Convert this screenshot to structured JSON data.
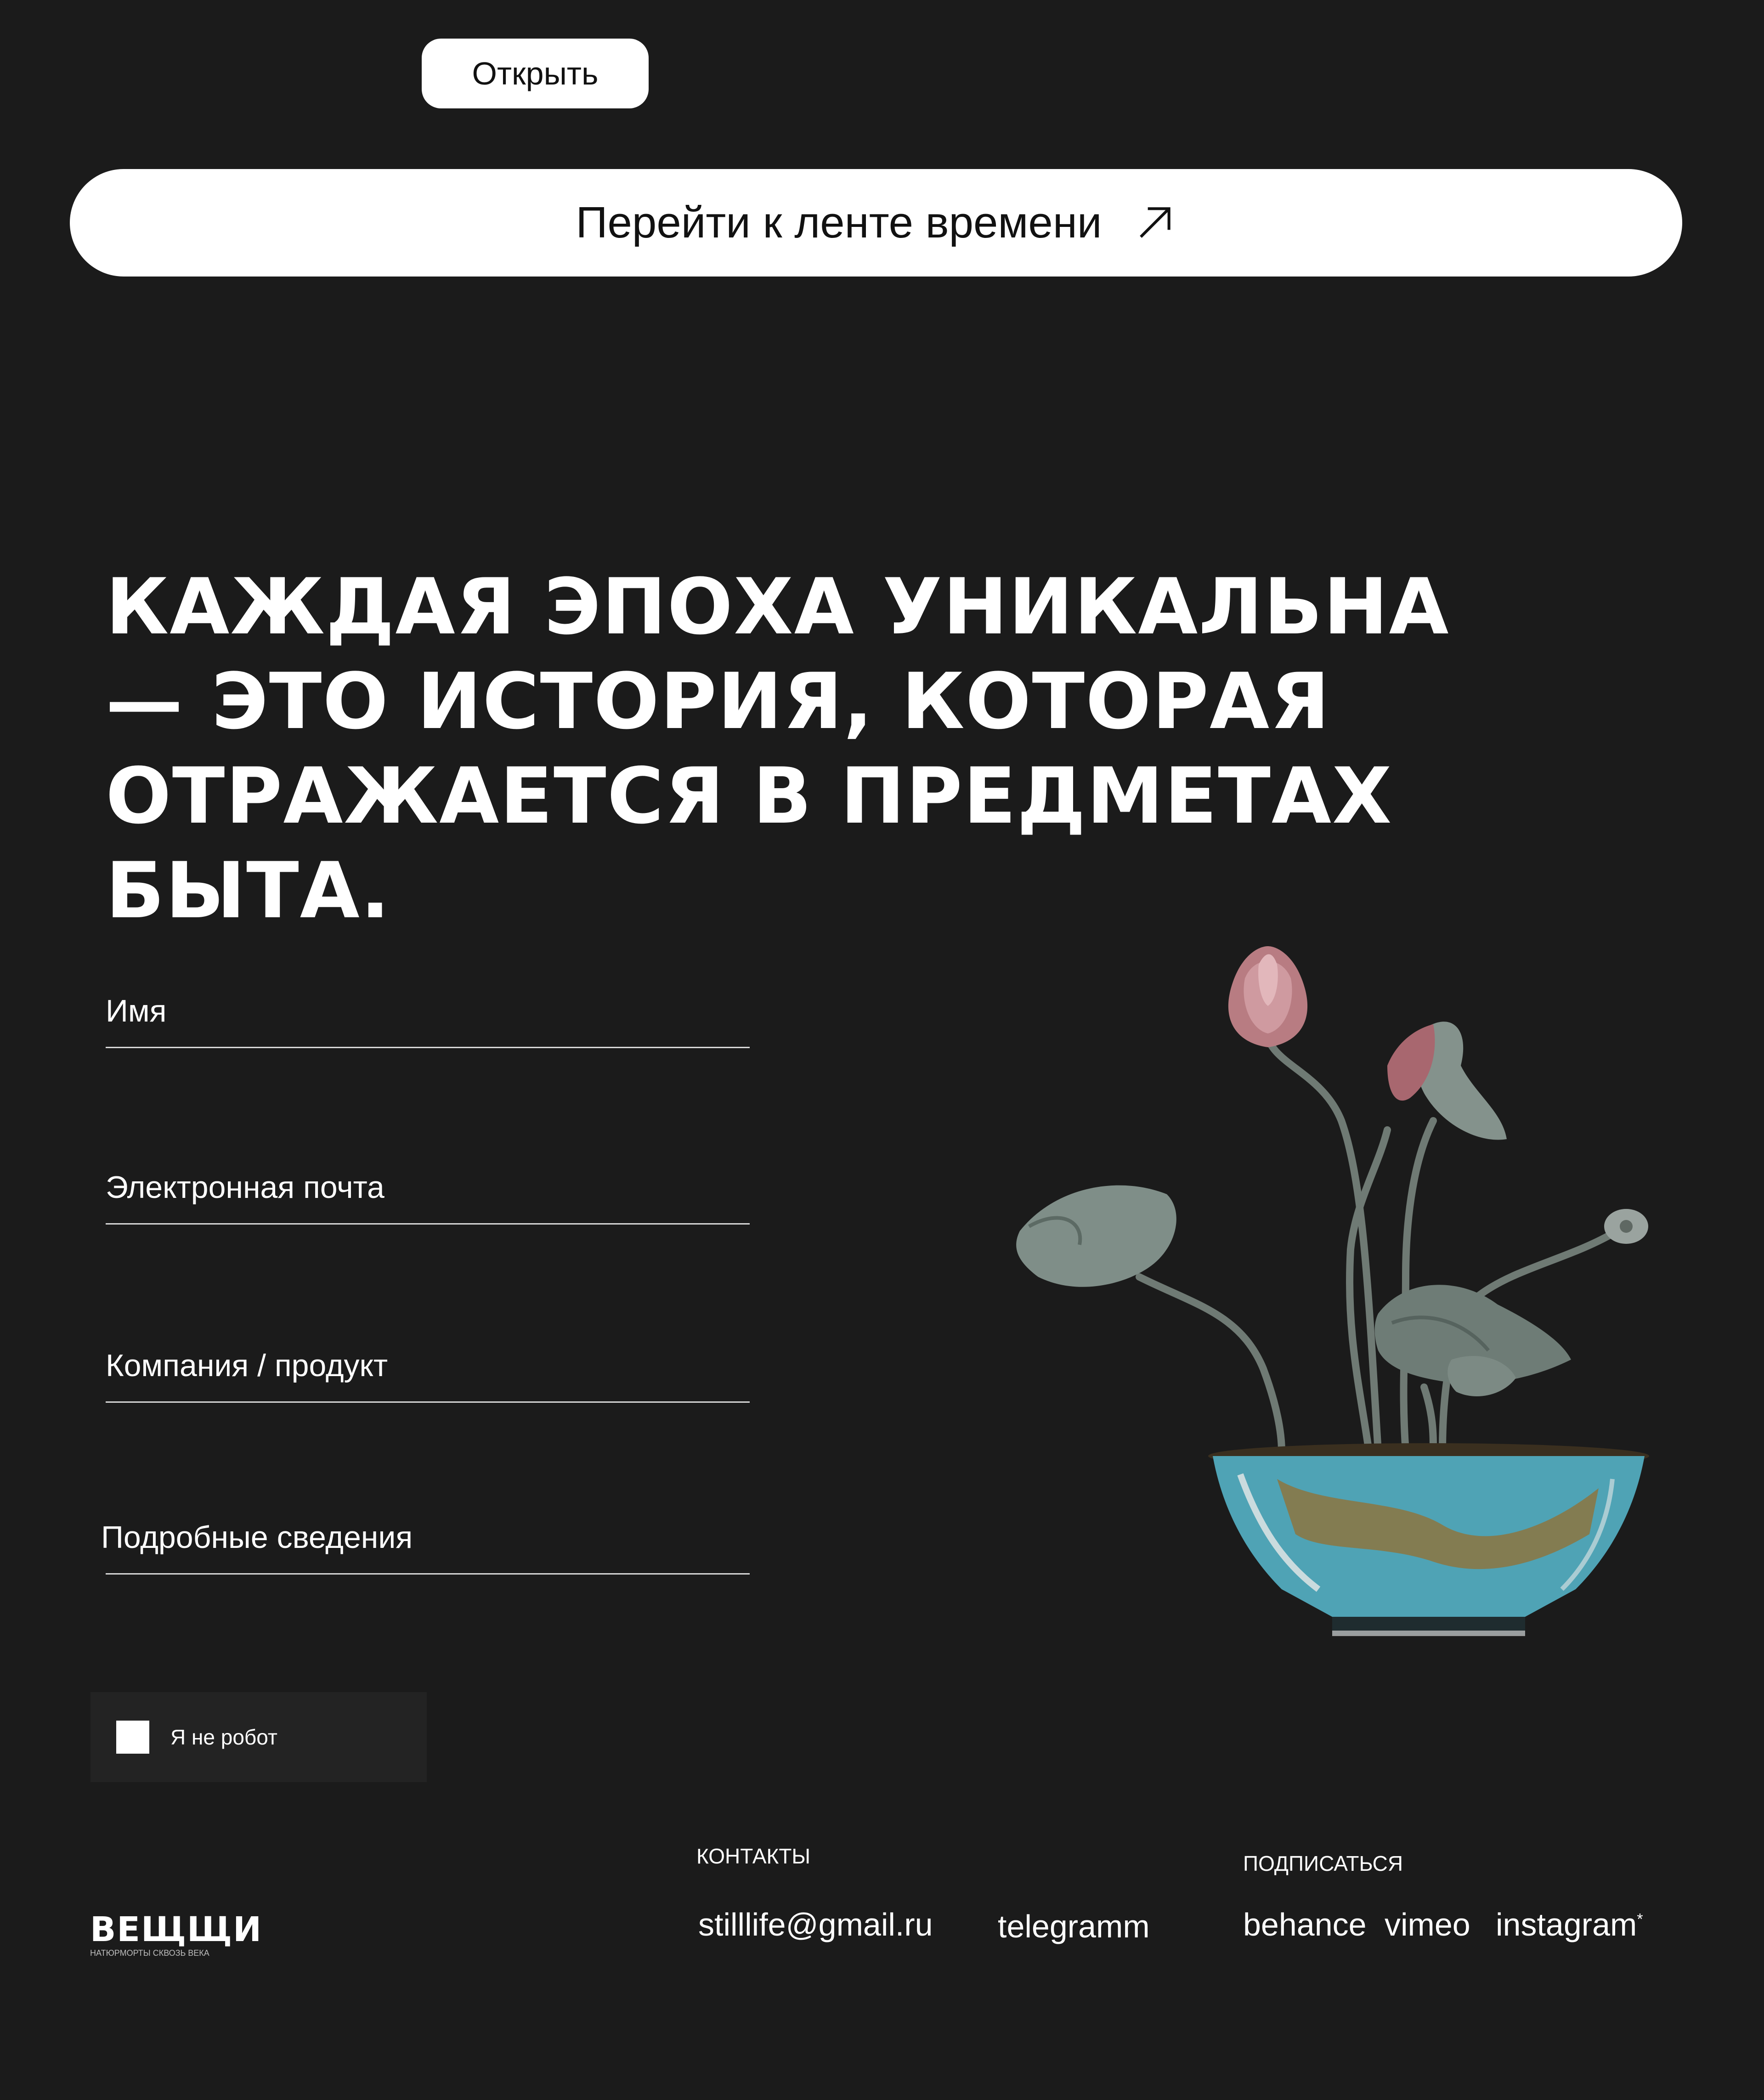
{
  "header": {
    "open_button": "Открыть",
    "timeline_button": "Перейти к ленте времени"
  },
  "headline": {
    "line1": "КАЖДАЯ ЭПОХА УНИКАЛЬНА",
    "line2": "— ЭТО ИСТОРИЯ, КОТОРАЯ",
    "line3": "ОТРАЖАЕТСЯ В ПРЕДМЕТАХ БЫТА."
  },
  "form": {
    "name_label": "Имя",
    "email_label": "Электронная почта",
    "company_label": "Компания / продукт",
    "details_label": "Подробные сведения",
    "captcha_label": "Я не робот"
  },
  "footer": {
    "logo_name": "ВЕЩЩИ",
    "logo_tagline": "НАТЮРМОРТЫ СКВОЗЬ ВЕКА",
    "contacts_title": "КОНТАКТЫ",
    "email": "stilllife@gmail.ru",
    "telegram": "telegramm",
    "subscribe_title": "ПОДПИСАТЬСЯ",
    "behance": "behance",
    "vimeo": "vimeo",
    "instagram": "instagram",
    "instagram_mark": "*"
  }
}
